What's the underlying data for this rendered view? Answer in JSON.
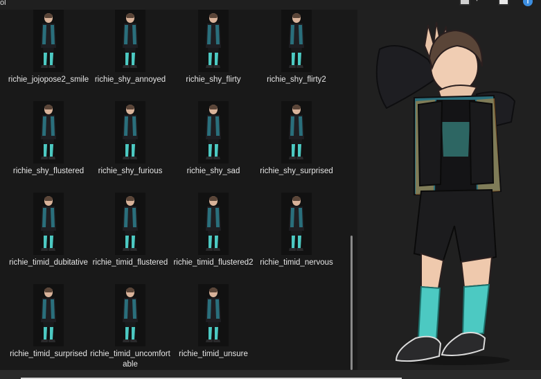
{
  "window": {
    "title_fragment": "ol"
  },
  "toolbar": {
    "view_icon": "view-options-icon",
    "chevron_icon": "chevron-down-icon",
    "preview_pane_icon": "preview-pane-icon",
    "info_icon": "info-icon"
  },
  "files": [
    {
      "name": "richie_jojopose2_smile"
    },
    {
      "name": "richie_shy_annoyed"
    },
    {
      "name": "richie_shy_flirty"
    },
    {
      "name": "richie_shy_flirty2"
    },
    {
      "name": "richie_shy_flustered"
    },
    {
      "name": "richie_shy_furious"
    },
    {
      "name": "richie_shy_sad"
    },
    {
      "name": "richie_shy_surprised"
    },
    {
      "name": "richie_timid_dubitative"
    },
    {
      "name": "richie_timid_flustered"
    },
    {
      "name": "richie_timid_flustered2"
    },
    {
      "name": "richie_timid_nervous"
    },
    {
      "name": "richie_timid_surprised"
    },
    {
      "name": "richie_timid_uncomfortable"
    },
    {
      "name": "richie_timid_unsure"
    }
  ],
  "colors": {
    "background": "#191919",
    "preview_background": "#202020",
    "accent_teal": "#4cc9c2",
    "info_blue": "#3b8de0"
  }
}
